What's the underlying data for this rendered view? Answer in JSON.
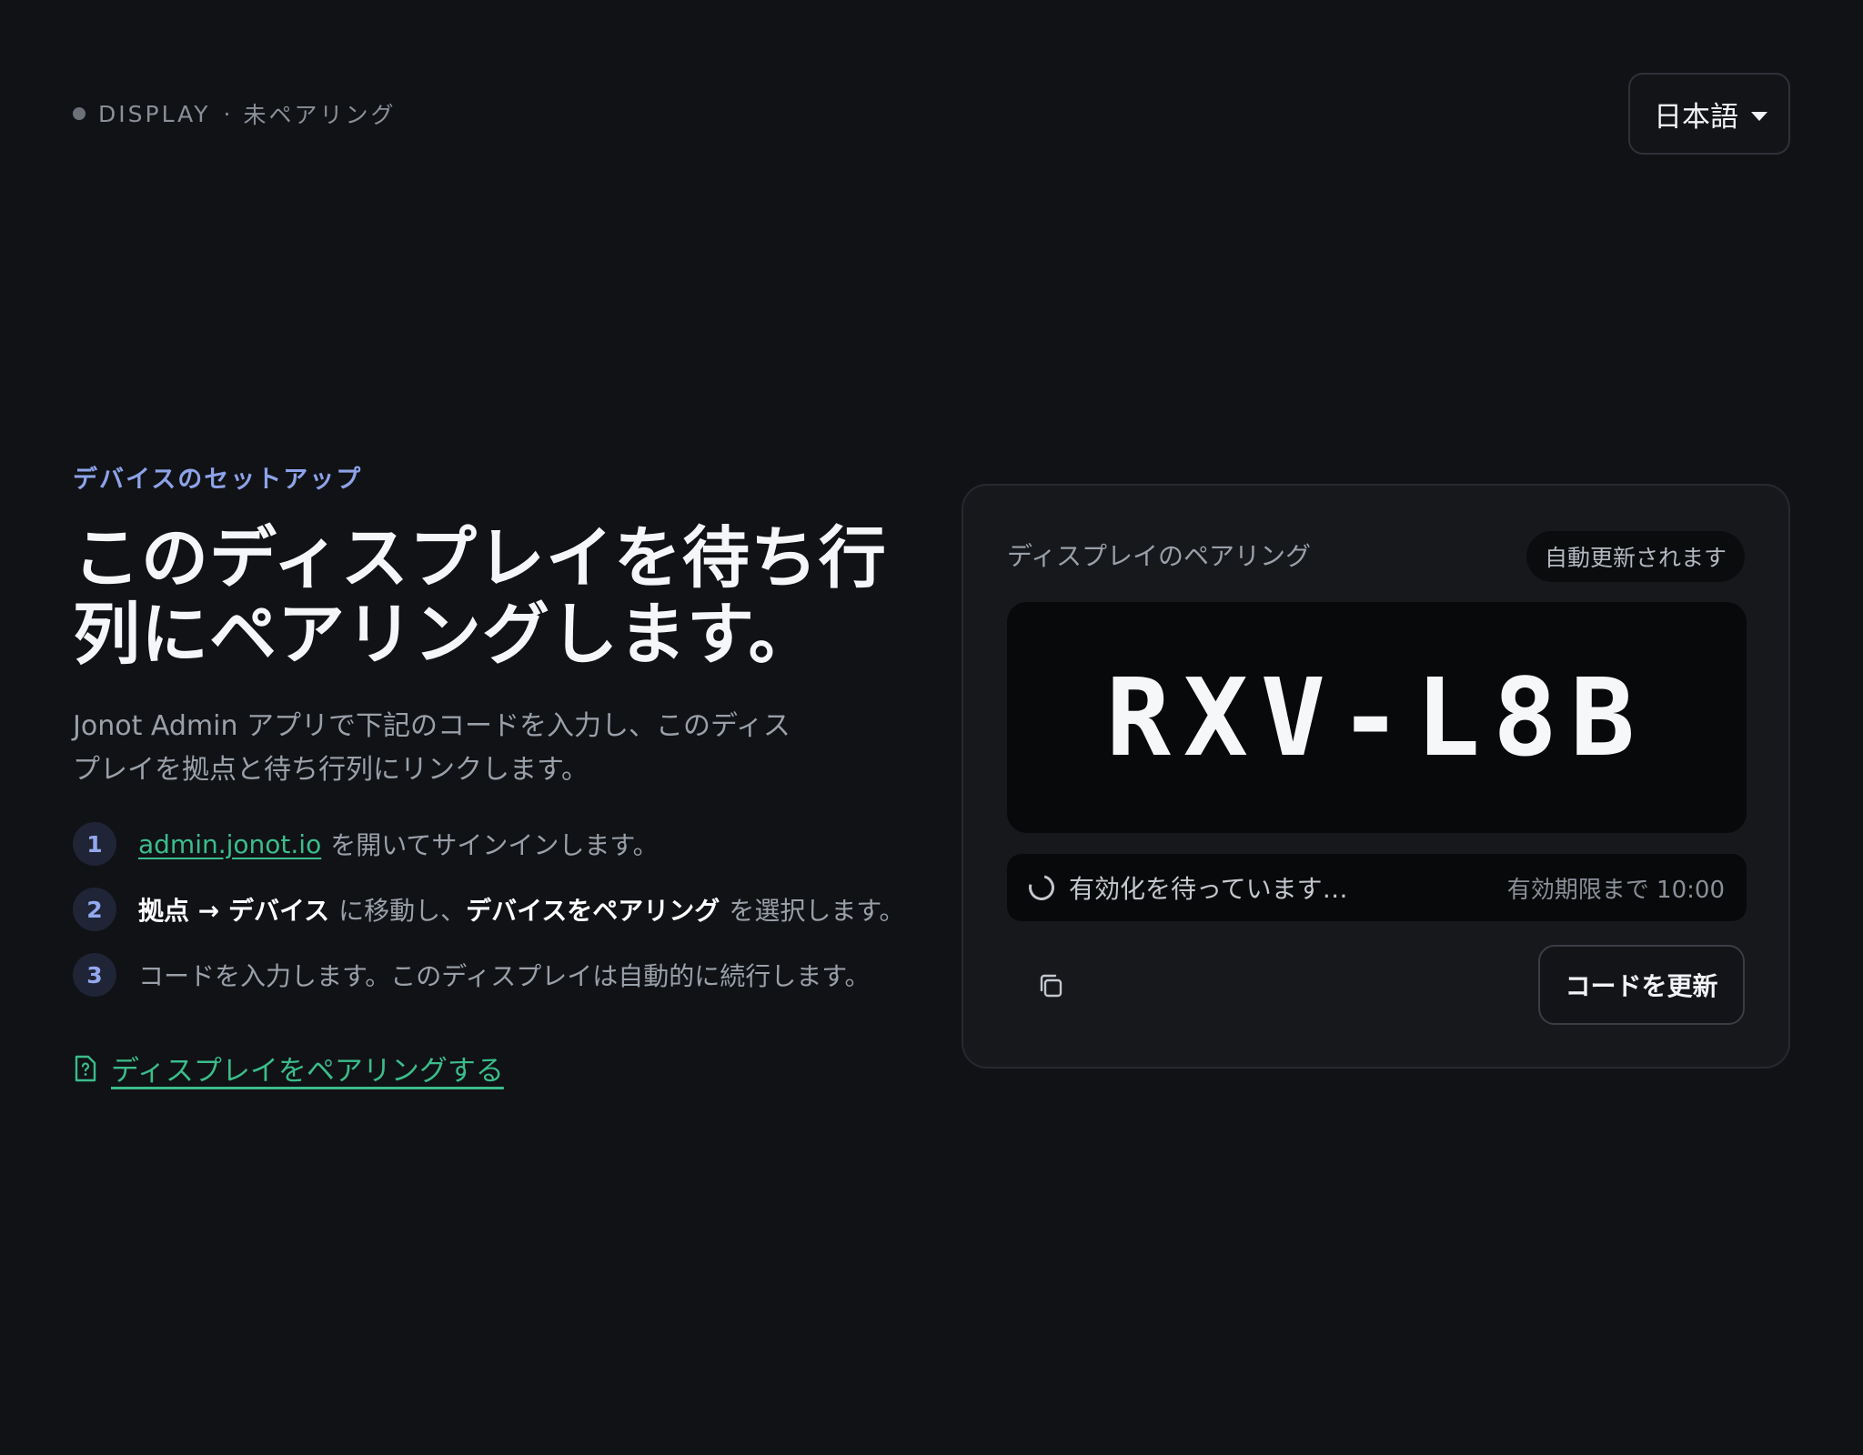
{
  "header": {
    "device_label": "DISPLAY",
    "separator": "·",
    "pairing_state": "未ペアリング",
    "language": "日本語"
  },
  "intro": {
    "eyebrow": "デバイスのセットアップ",
    "headline_line1": "このディスプレイを待ち行",
    "headline_line2": "列にペアリングします。",
    "lead_line1": "Jonot Admin アプリで下記のコードを入力し、このディス",
    "lead_line2": "プレイを拠点と待ち行列にリンクします。"
  },
  "steps": [
    {
      "number": "1",
      "link": "admin.jonot.io",
      "text": "を開いてサインインします。"
    },
    {
      "number": "2",
      "strong_1": "拠点 → デバイス",
      "text_1": "に移動し、",
      "strong_2": "デバイスをペアリング",
      "text_2": "を選択します。"
    },
    {
      "number": "3",
      "text": "コードを入力します。このディスプレイは自動的に続行します。"
    }
  ],
  "help_link": {
    "icon": "help-document-icon",
    "label": "ディスプレイをペアリングする"
  },
  "pairing_card": {
    "title": "ディスプレイのペアリング",
    "auto_refresh_badge": "自動更新されます",
    "code": "RXV-L8B",
    "waiting_text": "有効化を待っています…",
    "expiry_text": "有効期限まで 10:00",
    "copy_icon": "copy-icon",
    "refresh_button": "コードを更新"
  },
  "colors": {
    "background": "#101216",
    "accent_green": "#3bbd8a",
    "accent_blue": "#8ea2e8",
    "card_background": "#16181c"
  }
}
